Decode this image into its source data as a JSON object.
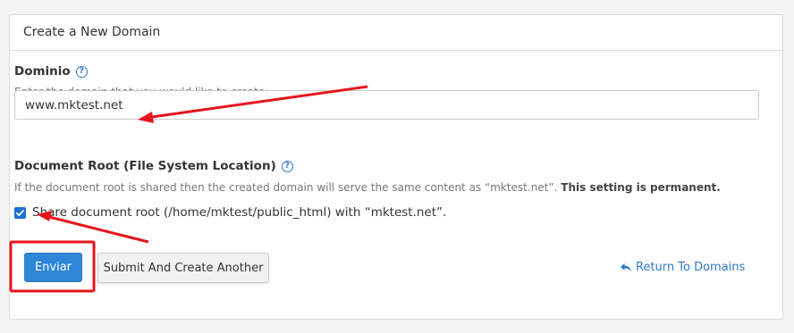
{
  "panel": {
    "title": "Create a New Domain"
  },
  "domain": {
    "label": "Dominio",
    "help": "Enter the domain that you would like to create:",
    "value": "www.mktest.net"
  },
  "docroot": {
    "label": "Document Root (File System Location)",
    "help": "If the document root is shared then the created domain will serve the same content as “mktest.net”.",
    "help_bold": "This setting is permanent.",
    "checkbox_label": "Share document root (/home/mktest/public_html) with “mktest.net”.",
    "checked": true
  },
  "actions": {
    "submit_label": "Enviar",
    "submit_another_label": "Submit And Create Another",
    "return_label": "Return To Domains"
  },
  "colors": {
    "accent": "#2f86d6",
    "link": "#2d78c8",
    "annotation": "#e8141c"
  }
}
